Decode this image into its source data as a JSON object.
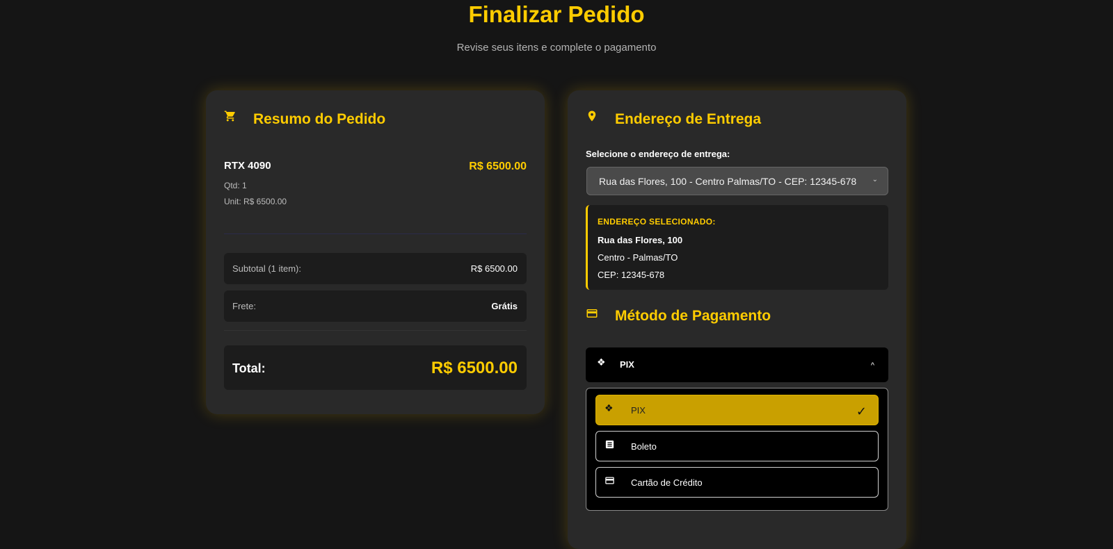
{
  "header": {
    "title": "Finalizar Pedido",
    "subtitle": "Revise seus itens e complete o pagamento"
  },
  "summary": {
    "icon": "cart-icon",
    "title": "Resumo do Pedido",
    "item": {
      "name": "RTX 4090",
      "price": "R$ 6500.00",
      "qty": "Qtd: 1",
      "unit": "Unit: R$ 6500.00"
    },
    "subtotal_label": "Subtotal (1 item):",
    "subtotal_value": "R$ 6500.00",
    "shipping_label": "Frete:",
    "shipping_value": "Grátis",
    "total_label": "Total:",
    "total_value": "R$ 6500.00"
  },
  "address": {
    "icon": "location-pin-icon",
    "title": "Endereço de Entrega",
    "select_label": "Selecione o endereço de entrega:",
    "selected_option": "Rua das Flores, 100 - Centro Palmas/TO - CEP: 12345-678",
    "box_header": "ENDEREÇO SELECIONADO:",
    "street": "Rua das Flores, 100",
    "city": "Centro - Palmas/TO",
    "cep": "CEP: 12345-678"
  },
  "payment": {
    "icon": "credit-card-icon",
    "title": "Método de Pagamento",
    "selected": "PIX",
    "options": [
      {
        "label": "PIX",
        "icon": "pix-icon",
        "selected": true
      },
      {
        "label": "Boleto",
        "icon": "document-icon",
        "selected": false
      },
      {
        "label": "Cartão de Crédito",
        "icon": "credit-card-icon",
        "selected": false
      }
    ],
    "check_mark": "✓"
  },
  "colors": {
    "accent": "#ffcc00",
    "background": "#151515",
    "card": "#292929",
    "selected_option": "#c9a000"
  }
}
